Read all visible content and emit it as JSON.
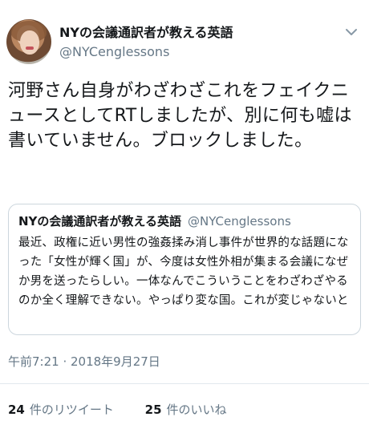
{
  "tweet": {
    "author": {
      "display_name": "NYの会議通訳者が教える英語",
      "handle": "@NYCenglessons"
    },
    "text": "河野さん自身がわざわざこれをフェイクニュースとしてRTしましたが、別に何も嘘は書いていません。ブロックしました。",
    "quoted": {
      "display_name": "NYの会議通訳者が教える英語",
      "handle": "@NYCenglessons",
      "text": "最近、政権に近い男性の強姦揉み消し事件が世界的な話題になった「女性が輝く国」が、今度は女性外相が集まる会議になぜか男を送ったらしい。一体なんでこういうことをわざわざやるのか全く理解できない。やっぱり変な国。これが変じゃないと思う人は愛国者…"
    },
    "timestamp": "午前7:21 · 2018年9月27日",
    "stats": {
      "retweets_count": "24",
      "retweets_label": "件のリツイート",
      "likes_count": "25",
      "likes_label": "件のいいね"
    }
  },
  "colors": {
    "text_primary": "#14171a",
    "text_secondary": "#657786",
    "border": "#ccd6dd"
  },
  "icons": {
    "menu": "chevron-down-icon"
  }
}
